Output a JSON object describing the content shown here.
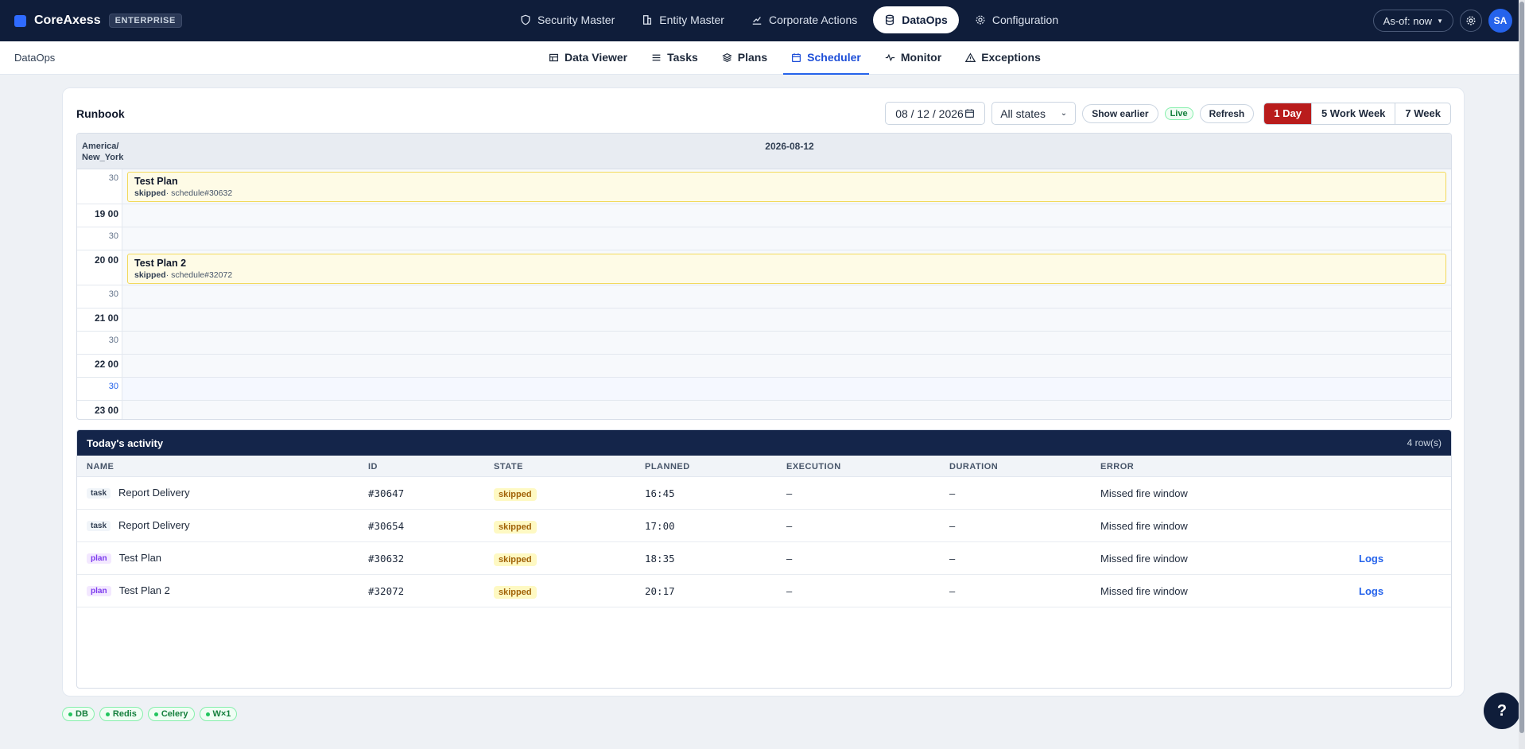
{
  "brand": {
    "name": "CoreAxess",
    "badge": "ENTERPRISE"
  },
  "nav": {
    "items": [
      {
        "label": "Security Master",
        "icon": "shield-icon"
      },
      {
        "label": "Entity Master",
        "icon": "building-icon"
      },
      {
        "label": "Corporate Actions",
        "icon": "chart-icon"
      },
      {
        "label": "DataOps",
        "icon": "database-icon",
        "active": true
      },
      {
        "label": "Configuration",
        "icon": "gear-icon"
      }
    ],
    "asof": "As-of: now",
    "avatar": "SA"
  },
  "breadcrumb": "DataOps",
  "subtabs": [
    {
      "label": "Data Viewer",
      "icon": "table-icon"
    },
    {
      "label": "Tasks",
      "icon": "list-icon"
    },
    {
      "label": "Plans",
      "icon": "layers-icon"
    },
    {
      "label": "Scheduler",
      "icon": "calendar-icon",
      "active": true
    },
    {
      "label": "Monitor",
      "icon": "pulse-icon"
    },
    {
      "label": "Exceptions",
      "icon": "warning-icon"
    }
  ],
  "runbook": {
    "title": "Runbook",
    "date": "08 / 12 / 2026",
    "state_filter": "All states",
    "show_earlier": "Show earlier",
    "live": "Live",
    "refresh": "Refresh",
    "views": [
      "1 Day",
      "5 Work Week",
      "7 Week"
    ]
  },
  "calendar": {
    "timezone": "America/ New_York",
    "day": "2026-08-12",
    "slots": [
      {
        "label": "30",
        "hour": false
      },
      {
        "label": "19 00",
        "hour": true
      },
      {
        "label": "30",
        "hour": false
      },
      {
        "label": "20 00",
        "hour": true
      },
      {
        "label": "30",
        "hour": false
      },
      {
        "label": "21 00",
        "hour": true
      },
      {
        "label": "30",
        "hour": false
      },
      {
        "label": "22 00",
        "hour": true
      },
      {
        "label": "30",
        "hour": false,
        "now": true
      },
      {
        "label": "23 00",
        "hour": true
      }
    ],
    "events": [
      {
        "title": "Test Plan",
        "state": "skipped",
        "ref": "· schedule#30632"
      },
      {
        "title": "Test Plan 2",
        "state": "skipped",
        "ref": "· schedule#32072"
      }
    ]
  },
  "activity": {
    "title": "Today's activity",
    "count": "4 row(s)",
    "columns": [
      "NAME",
      "ID",
      "STATE",
      "PLANNED",
      "EXECUTION",
      "DURATION",
      "ERROR"
    ],
    "rows": [
      {
        "kind": "task",
        "name": "Report Delivery",
        "id": "#30647",
        "state": "skipped",
        "planned": "16:45",
        "execution": "–",
        "duration": "–",
        "error": "Missed fire window",
        "action": ""
      },
      {
        "kind": "task",
        "name": "Report Delivery",
        "id": "#30654",
        "state": "skipped",
        "planned": "17:00",
        "execution": "–",
        "duration": "–",
        "error": "Missed fire window",
        "action": ""
      },
      {
        "kind": "plan",
        "name": "Test Plan",
        "id": "#30632",
        "state": "skipped",
        "planned": "18:35",
        "execution": "–",
        "duration": "–",
        "error": "Missed fire window",
        "action": "Logs"
      },
      {
        "kind": "plan",
        "name": "Test Plan 2",
        "id": "#32072",
        "state": "skipped",
        "planned": "20:17",
        "execution": "–",
        "duration": "–",
        "error": "Missed fire window",
        "action": "Logs"
      }
    ]
  },
  "status_chips": [
    "DB",
    "Redis",
    "Celery",
    "W×1"
  ],
  "help": "?"
}
